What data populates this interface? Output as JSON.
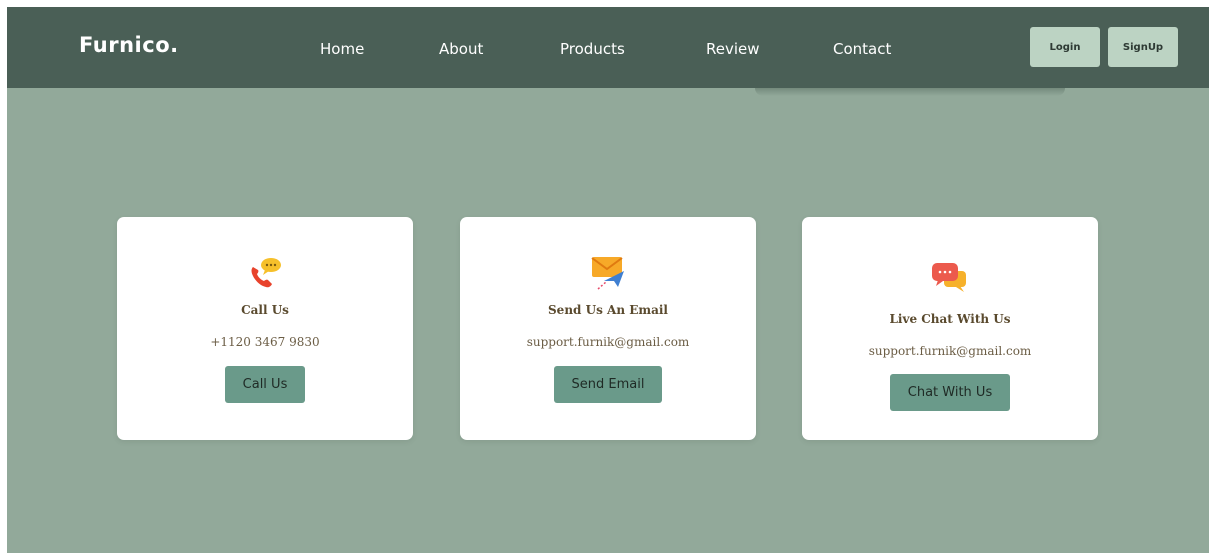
{
  "navbar": {
    "brand": "Furnico.",
    "links": [
      "Home",
      "About",
      "Products",
      "Review",
      "Contact"
    ],
    "login_label": "Login",
    "signup_label": "SignUp"
  },
  "cards": [
    {
      "icon": "phone-call-icon",
      "title": "Call Us",
      "text": "+1120 3467 9830",
      "button": "Call Us"
    },
    {
      "icon": "email-send-icon",
      "title": "Send Us An Email",
      "text": "support.furnik@gmail.com",
      "button": "Send Email"
    },
    {
      "icon": "chat-bubbles-icon",
      "title": "Live Chat With Us",
      "text": "support.furnik@gmail.com",
      "button": "Chat With Us"
    }
  ],
  "colors": {
    "navbar_bg": "#4a5f56",
    "page_bg": "#92a99a",
    "auth_button_bg": "#bcd3c3",
    "card_button_bg": "#6a9a8a",
    "card_bg": "#ffffff"
  }
}
